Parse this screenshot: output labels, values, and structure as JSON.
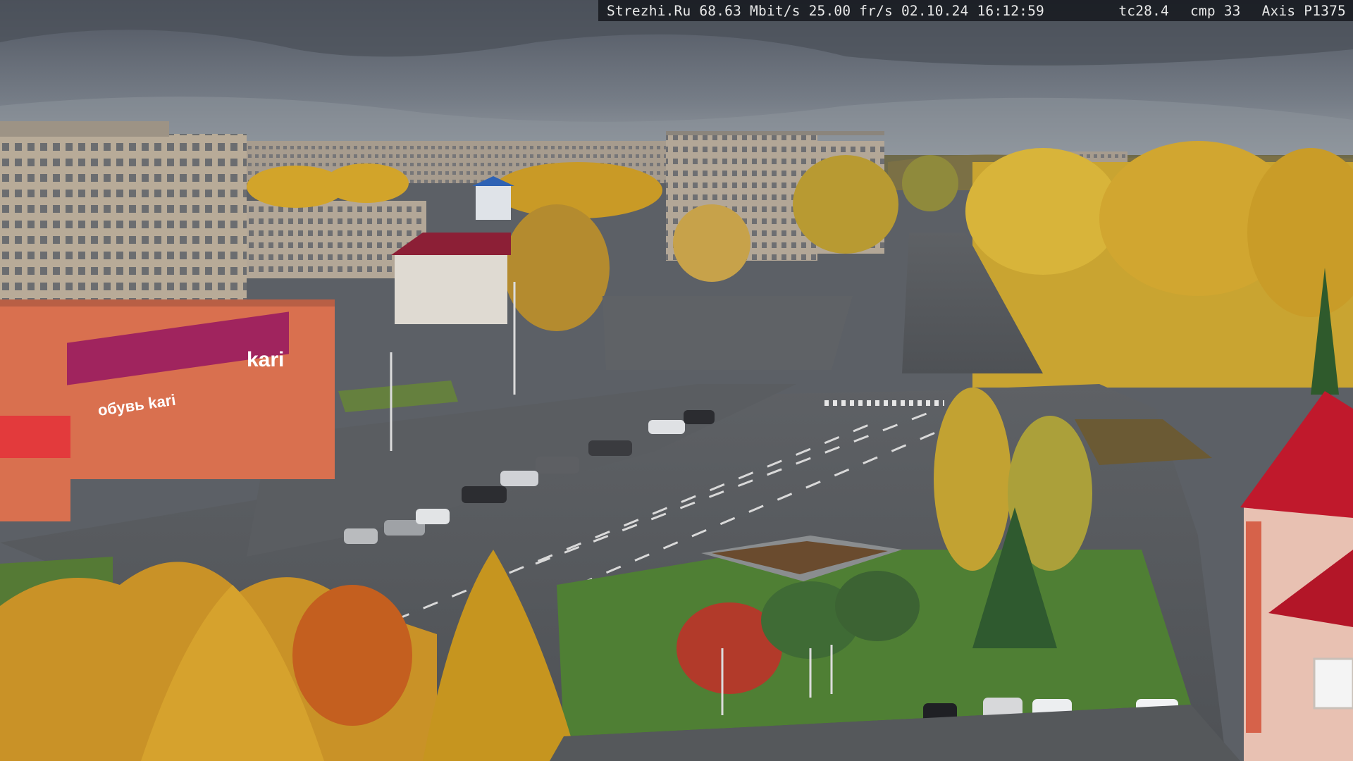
{
  "camera_overlay": {
    "site": "Strezhi.Ru",
    "bitrate": "68.63 Mbit/s",
    "framerate": "25.00 fr/s",
    "date": "02.10.24",
    "time": "16:12:59",
    "tc": "tc28.4",
    "cmp": "cmp 33",
    "camera_model": "Axis P1375"
  },
  "signage": {
    "store_logo": "kari",
    "store_banner": "обувь kari"
  },
  "scene": {
    "type": "webcam street view",
    "palette": {
      "sky": "#6f7580",
      "road": "#55585c",
      "grass": "#4f7a3a",
      "autumn_foliage": "#d8a628",
      "storefront_magenta": "#a0245e",
      "building_brick": "#d9714e",
      "roof_red": "#c0192c"
    }
  }
}
